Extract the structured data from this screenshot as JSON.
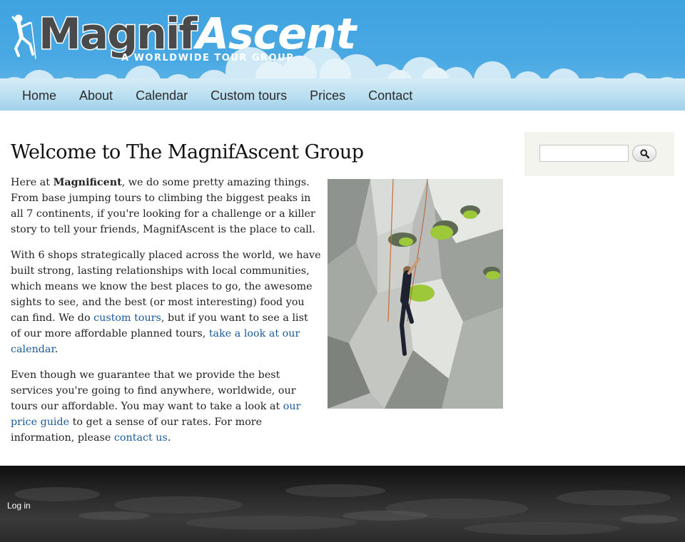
{
  "header": {
    "brand_part1": "Magnif",
    "brand_part2": "Ascent",
    "tagline": "A WORLDWIDE TOUR GROUP",
    "colors": {
      "sky": "#4aa9e3",
      "cloud": "#d4ecf6"
    }
  },
  "nav": {
    "items": [
      {
        "label": "Home"
      },
      {
        "label": "About"
      },
      {
        "label": "Calendar"
      },
      {
        "label": "Custom tours"
      },
      {
        "label": "Prices"
      },
      {
        "label": "Contact"
      }
    ]
  },
  "main": {
    "title": "Welcome to The MagnifAscent Group",
    "p1_lead": " Here at ",
    "p1_bold": "Magnificent",
    "p1_rest": ", we do some pretty amazing things. From base jumping tours to climbing the biggest peaks in all 7 continents, if you're looking for a challenge or a killer story to tell your friends, MagnifAscent is the place to call.",
    "p2_a": "With 6 shops strategically placed across the world, we have built strong, lasting relationships with local communities, which means we know the best places to go, the awesome sights to see, and the best (or most interesting) food you can find. We do ",
    "p2_link1": "custom tours",
    "p2_b": ", but if you want to see a list of our more affordable planned tours, ",
    "p2_link2": "take a look at our calendar",
    "p2_c": ".",
    "p3_a": "Even though we guarantee that we provide the best services you're going to find anywhere, worldwide, our tours our affordable. You may want to take a look at ",
    "p3_link1": "our price guide",
    "p3_b": " to get a sense of our rates. For more information, please ",
    "p3_link2": "contact us",
    "p3_c": ".",
    "link_color": "#1a5a9a"
  },
  "sidebar": {
    "search": {
      "value": "",
      "placeholder": ""
    },
    "search_icon": "search-icon"
  },
  "footer": {
    "login_label": "Log in"
  }
}
